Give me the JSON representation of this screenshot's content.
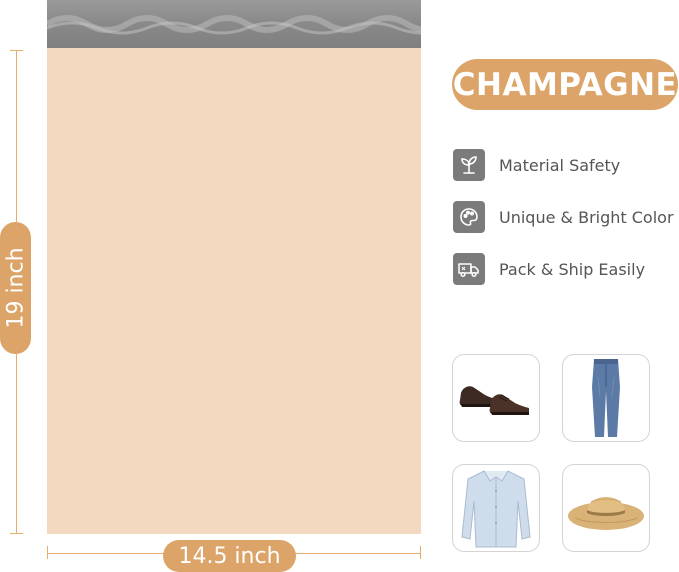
{
  "product": {
    "color_name": "CHAMPAGNE",
    "bag_color": "#f3d9bf",
    "accent_color": "#dca468",
    "icon_bg_color": "#7b7b7b"
  },
  "dimensions": {
    "height_label": "19 inch",
    "width_label": "14.5 inch"
  },
  "features": [
    {
      "label": "Material Safety",
      "icon": "sprout-icon"
    },
    {
      "label": "Unique & Bright Color",
      "icon": "palette-icon"
    },
    {
      "label": "Pack & Ship Easily",
      "icon": "delivery-truck-icon"
    }
  ],
  "items": [
    {
      "icon": "dress-shoes-icon"
    },
    {
      "icon": "jeans-icon"
    },
    {
      "icon": "dress-shirt-icon"
    },
    {
      "icon": "sun-hat-icon"
    }
  ]
}
